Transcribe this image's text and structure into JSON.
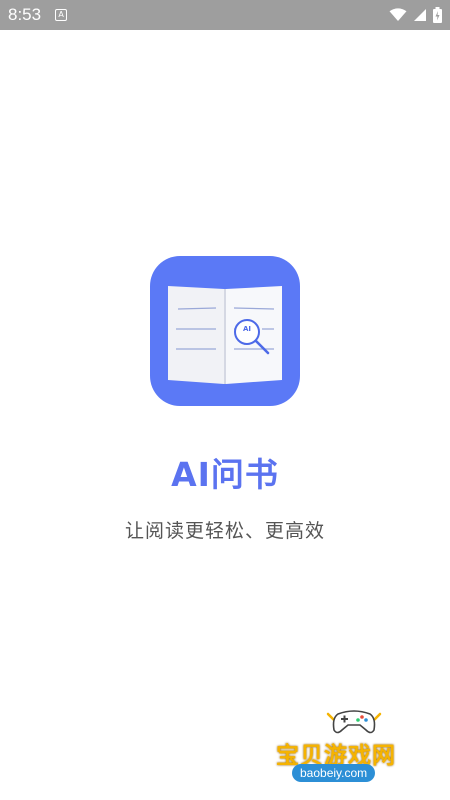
{
  "status_bar": {
    "time": "8:53",
    "notification_icon": "android-notification-icon",
    "notification_glyph": "A",
    "wifi_icon": "wifi-icon",
    "signal_icon": "cell-signal-icon",
    "battery_icon": "battery-icon"
  },
  "splash": {
    "logo_icon": "open-book-ai-magnifier-icon",
    "logo_badge": "AI",
    "title": "AI问书",
    "subtitle": "让阅读更轻松、更高效"
  },
  "watermark": {
    "title": "宝贝游戏网",
    "url": "baobeiy.com",
    "icon": "gamepad-icon"
  },
  "colors": {
    "status_bar": "#9e9e9e",
    "accent": "#5b73f0",
    "icon_bg": "#5b79f6",
    "subtitle": "#555555",
    "watermark_yellow": "#f5b301",
    "watermark_blue": "#2c8fd6"
  }
}
